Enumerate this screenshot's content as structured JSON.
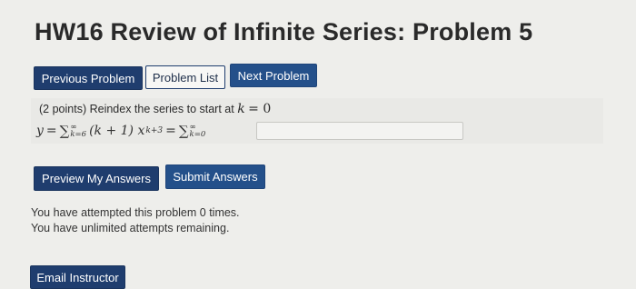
{
  "page": {
    "title": "HW16 Review of Infinite Series: Problem 5"
  },
  "nav": {
    "previous_label": "Previous Problem",
    "list_label": "Problem List",
    "next_label": "Next Problem"
  },
  "problem": {
    "points": "(2 points)",
    "instruction": "Reindex the series to start at",
    "target_var": "k",
    "target_eq": "= 0",
    "lhs_var": "y",
    "lhs_eq": "=",
    "sum_upper": "∞",
    "sum_lower_1": "k=6",
    "summand": "(k + 1) x",
    "exponent": "k+3",
    "mid_eq": "=",
    "sum_lower_2": "k=0",
    "answer_value": ""
  },
  "actions": {
    "preview_label": "Preview My Answers",
    "submit_label": "Submit Answers"
  },
  "status": {
    "attempts_line": "You have attempted this problem 0 times.",
    "remaining_line": "You have unlimited attempts remaining."
  },
  "footer": {
    "email_label": "Email Instructor"
  },
  "colors": {
    "primary_button": "#1f3d6e",
    "secondary_button_bg": "#f7f7f5",
    "page_bg": "#eeeeeb"
  }
}
